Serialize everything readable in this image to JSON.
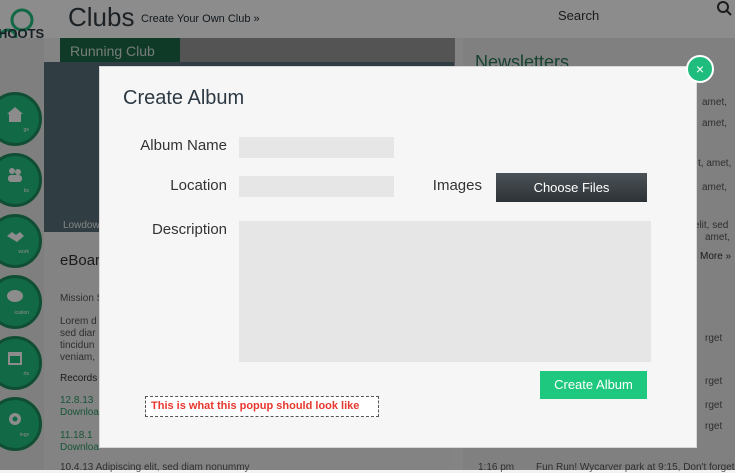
{
  "header": {
    "logo_text": "HOOTS",
    "title": "Clubs",
    "create_club_link": "Create Your Own Club »",
    "search_label": "Search"
  },
  "sidebar": {
    "items": [
      {
        "label": "ge",
        "icon": "home-icon"
      },
      {
        "label": "bs",
        "icon": "people-icon"
      },
      {
        "label": "work",
        "icon": "handshake-icon"
      },
      {
        "label": "ication",
        "icon": "chat-icon"
      },
      {
        "label": "rts",
        "icon": "calendar-icon"
      },
      {
        "label": "ings",
        "icon": "gear-icon"
      }
    ]
  },
  "background": {
    "club_name": "Running Club",
    "newsletters": "Newsletters",
    "caption": "Lowdow",
    "eboard": "eBoar",
    "mission": "Mission S",
    "lorem1": "Lorem d",
    "lorem2": "sed diar",
    "lorem3": "tincidun",
    "lorem4": "veniam,",
    "records": "Records",
    "rec1_date": "12.8.13",
    "rec1_link": "Downloa",
    "rec2_date": "11.18.1",
    "rec2_link": "Downloa",
    "rec3": "10.4.13  Adipiscing elit, sed diam nonummy",
    "right1": "amet,",
    "right2": "amet,",
    "right3": "t, amet,",
    "right4": "amet,",
    "right5": "ng elit, sed",
    "right6": "amet,",
    "more": "More »",
    "forget1": "rget",
    "forget2": "rget",
    "forget3": "rget",
    "forget4": "rget",
    "bottom_event": "Fun Run! Wycarver park at 9:15, Don't forget",
    "bottom_time": "1:16 pm"
  },
  "modal": {
    "title": "Create Album",
    "album_name_label": "Album Name",
    "location_label": "Location",
    "images_label": "Images",
    "choose_files": "Choose Files",
    "description_label": "Description",
    "create_button": "Create Album",
    "note": "This is what this popup should look like",
    "album_name_value": "",
    "location_value": "",
    "description_value": "",
    "close_symbol": "×"
  }
}
